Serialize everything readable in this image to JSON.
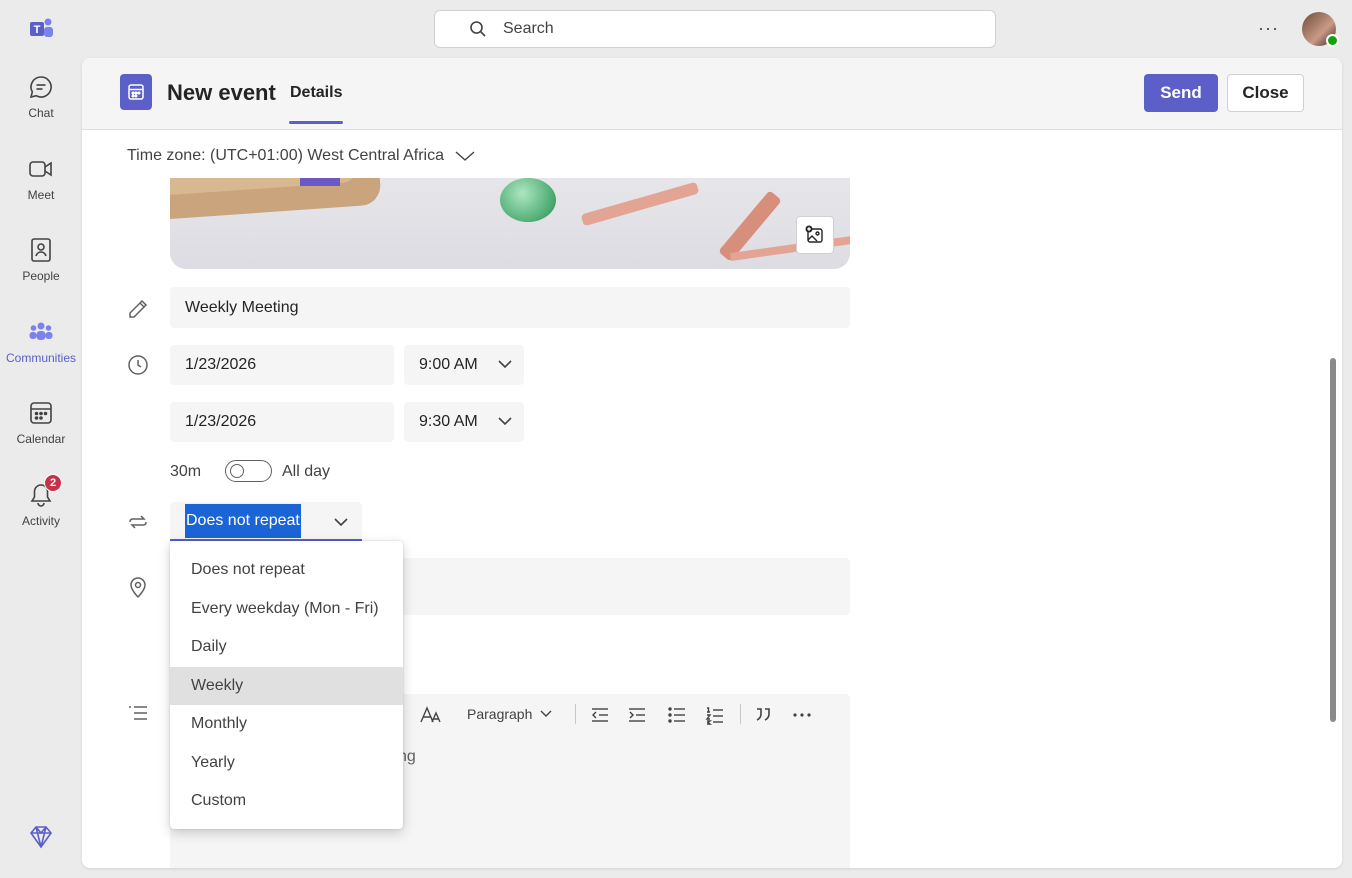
{
  "rail": {
    "items": [
      {
        "label": "Chat",
        "icon": "chat-icon"
      },
      {
        "label": "Meet",
        "icon": "video-icon"
      },
      {
        "label": "People",
        "icon": "people-icon"
      },
      {
        "label": "Communities",
        "icon": "communities-icon"
      },
      {
        "label": "Calendar",
        "icon": "calendar-icon"
      },
      {
        "label": "Activity",
        "icon": "bell-icon",
        "badge": "2"
      }
    ]
  },
  "search": {
    "placeholder": "Search"
  },
  "top": {
    "more": "···"
  },
  "header": {
    "title": "New event",
    "tab": "Details",
    "send": "Send",
    "close": "Close"
  },
  "form": {
    "timezone": "Time zone: (UTC+01:00) West Central Africa",
    "title": "Weekly Meeting",
    "start_date": "1/23/2026",
    "start_time": "9:00 AM",
    "end_date": "1/23/2026",
    "end_time": "9:30 AM",
    "duration": "30m",
    "all_day": "All day",
    "repeat": "Does not repeat",
    "editor_placeholder_fragment": "ting"
  },
  "editor_toolbar": {
    "paragraph": "Paragraph"
  },
  "repeat_menu": {
    "options": [
      "Does not repeat",
      "Every weekday (Mon - Fri)",
      "Daily",
      "Weekly",
      "Monthly",
      "Yearly",
      "Custom"
    ],
    "highlighted": "Weekly"
  },
  "colors": {
    "accent": "#5b5fc7",
    "selection": "#1a64d6",
    "badge": "#c4314b"
  }
}
